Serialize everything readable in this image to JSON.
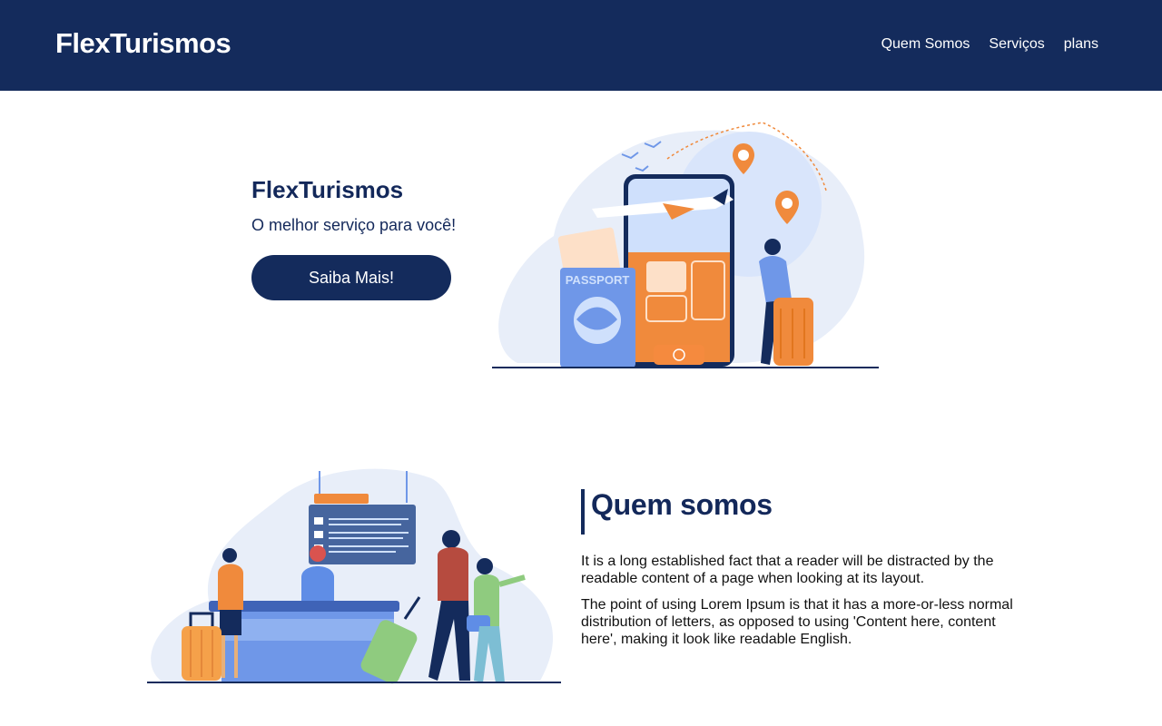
{
  "header": {
    "brand": "FlexTurismos",
    "nav": [
      "Quem Somos",
      "Serviços",
      "plans"
    ]
  },
  "hero": {
    "title": "FlexTurismos",
    "subtitle": "O melhor serviço para você!",
    "cta_label": "Saiba Mais!",
    "illustration_text": "PASSPORT"
  },
  "about": {
    "title": "Quem somos",
    "paragraphs": [
      "It is a long established fact that a reader will be distracted by the readable content of a page when looking at its layout.",
      "The point of using Lorem Ipsum is that it has a more-or-less normal distribution of letters, as opposed to using 'Content here, content here', making it look like readable English."
    ]
  },
  "colors": {
    "navy": "#142b5c",
    "accent": "#f08a3c",
    "blue": "#6f97e8",
    "white": "#ffffff"
  }
}
